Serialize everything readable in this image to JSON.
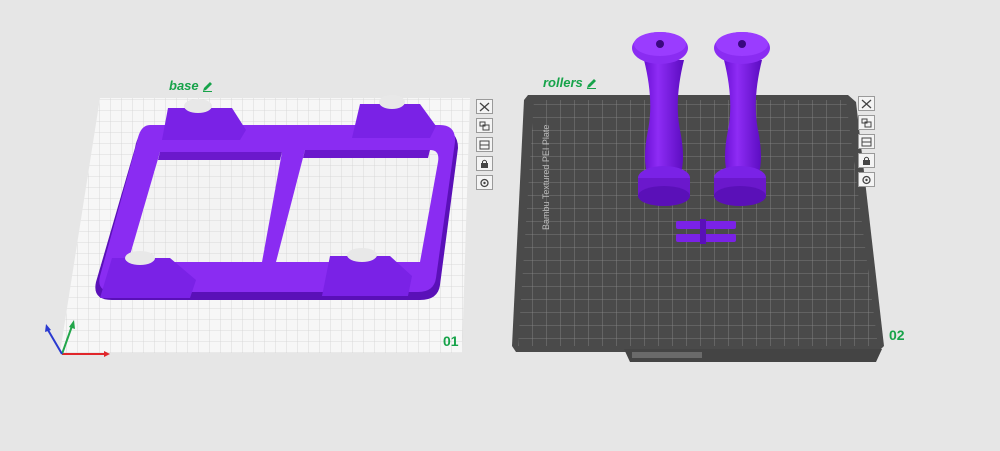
{
  "plates": [
    {
      "name": "base",
      "index": "01",
      "edit_icon": "pencil-icon",
      "bed_texture": "light-grid"
    },
    {
      "name": "rollers",
      "index": "02",
      "edit_icon": "pencil-icon",
      "bed_texture": "dark-textured-pei",
      "bed_label": "Bambu Textured PEI Plate"
    }
  ],
  "plate_tools": [
    "close-icon",
    "arrange-icon",
    "orient-icon",
    "lock-icon",
    "settings-icon"
  ],
  "colors": {
    "background": "#e6e6e6",
    "model": "#7b1fe6",
    "plate_label": "#17a34a",
    "axis_x": "#e0262b",
    "axis_y": "#22a64a",
    "axis_z": "#2a3ad0"
  }
}
